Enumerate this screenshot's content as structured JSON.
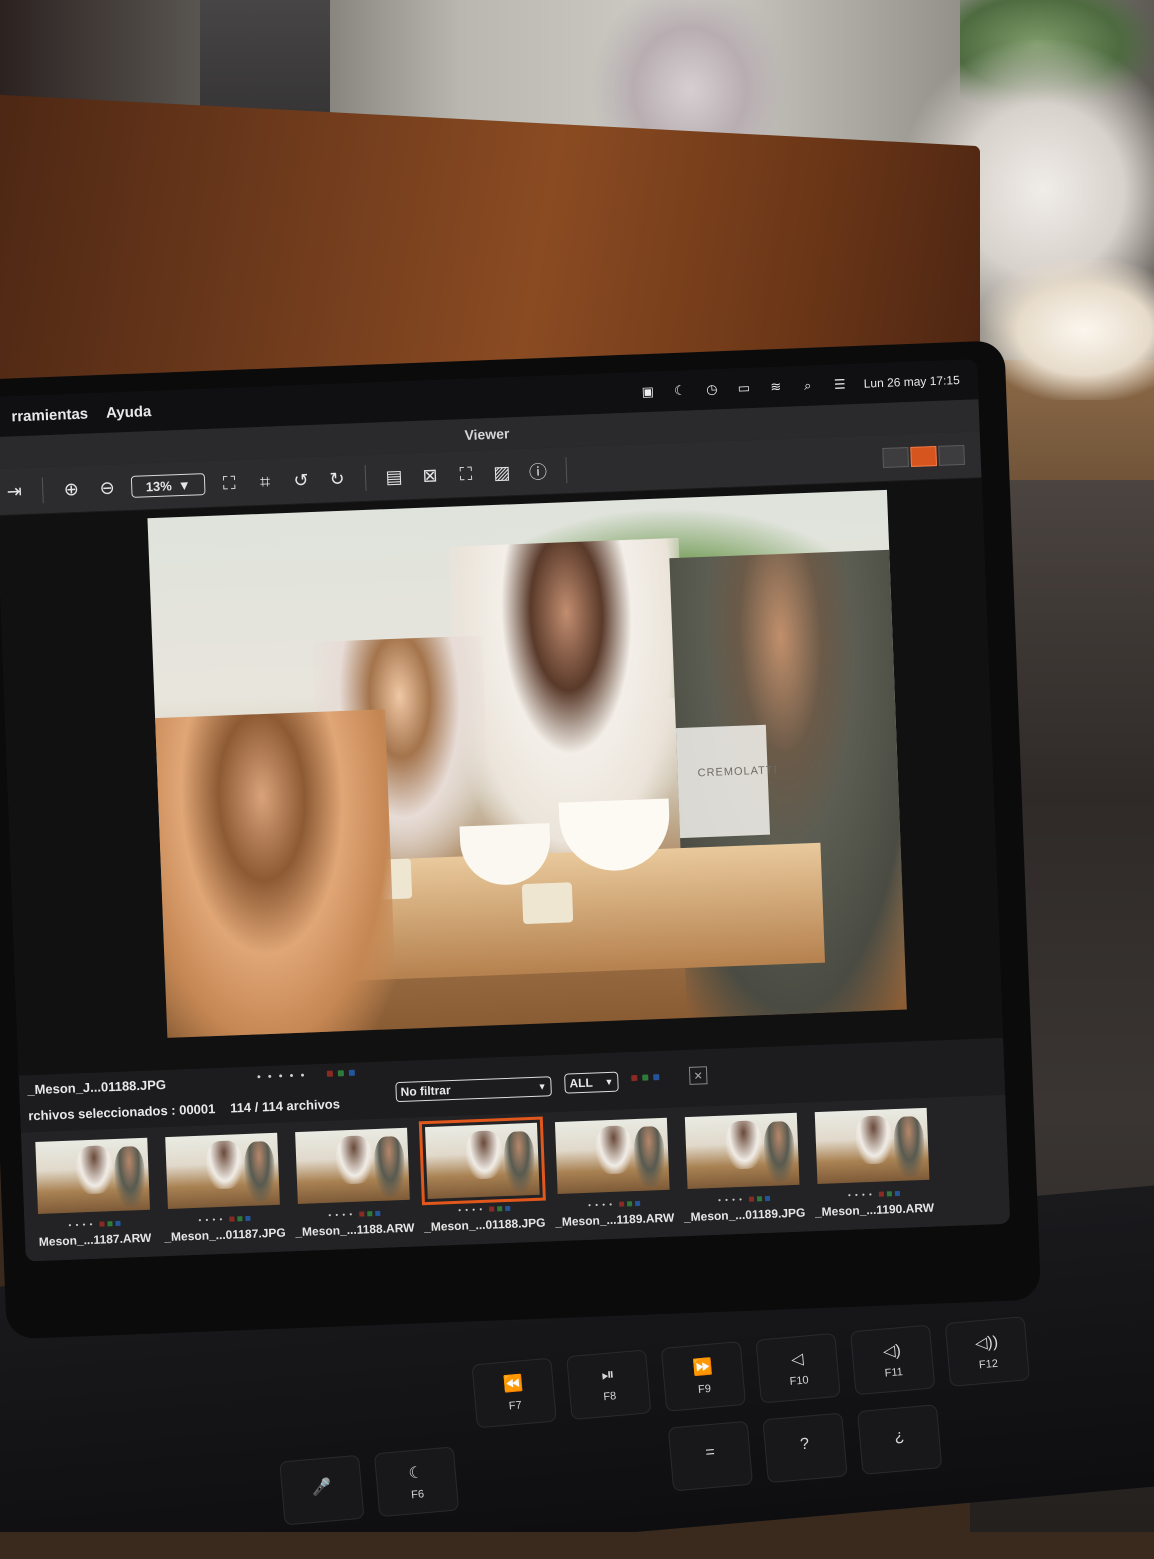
{
  "menubar": {
    "menus": [
      "rramientas",
      "Ayuda"
    ],
    "datetime": "Lun 26 may 17:15"
  },
  "window": {
    "title": "Viewer"
  },
  "toolbar": {
    "zoom_value": "13%",
    "icons": [
      "exit-icon",
      "zoom-in-icon",
      "zoom-out-icon",
      "fit-icon",
      "fill-icon",
      "rotate-left-icon",
      "rotate-right-icon",
      "layout-icon",
      "compare-icon",
      "fullscreen-icon",
      "image-icon",
      "info-icon"
    ],
    "view_modes": [
      "grid",
      "viewer",
      "split"
    ],
    "active_view_mode": "viewer"
  },
  "photo": {
    "brand": "CREMOLATTI"
  },
  "info": {
    "filename": "_Meson_J...01188.JPG",
    "rating": "• • • • •",
    "selected_text": "rchivos seleccionados : 00001",
    "count_text": "114 / 114 archivos",
    "filter_value": "No filtrar",
    "group_value": "ALL",
    "clear_symbol": "✕"
  },
  "colors": {
    "accent": "#e2571c",
    "labels": [
      "#c0392b",
      "#3aa84a",
      "#2c6fd1"
    ]
  },
  "filmstrip": [
    {
      "label": "Meson_...1187.ARW",
      "rating": "• • • •"
    },
    {
      "label": "_Meson_...01187.JPG",
      "rating": "• • • •"
    },
    {
      "label": "_Meson_...1188.ARW",
      "rating": "• • • •"
    },
    {
      "label": "_Meson_...01188.JPG",
      "rating": "• • • •",
      "selected": true
    },
    {
      "label": "_Meson_...1189.ARW",
      "rating": "• • • •"
    },
    {
      "label": "_Meson_...01189.JPG",
      "rating": "• • • •"
    },
    {
      "label": "_Meson_...1190.ARW",
      "rating": "• • • •"
    }
  ],
  "keyboard": {
    "row1": [
      {
        "glyph": "⏪",
        "label": "F7"
      },
      {
        "glyph": "⏯",
        "label": "F8"
      },
      {
        "glyph": "⏩",
        "label": "F9"
      },
      {
        "glyph": "◁",
        "label": "F10"
      },
      {
        "glyph": "◁)",
        "label": "F11"
      },
      {
        "glyph": "◁))",
        "label": "F12"
      }
    ],
    "row2": [
      {
        "glyph": "🎤",
        "label": ""
      },
      {
        "glyph": "☾",
        "label": "F6"
      },
      {
        "glyph": "=",
        "label": ""
      },
      {
        "glyph": "?",
        "label": ""
      },
      {
        "glyph": "¿",
        "label": ""
      }
    ]
  }
}
